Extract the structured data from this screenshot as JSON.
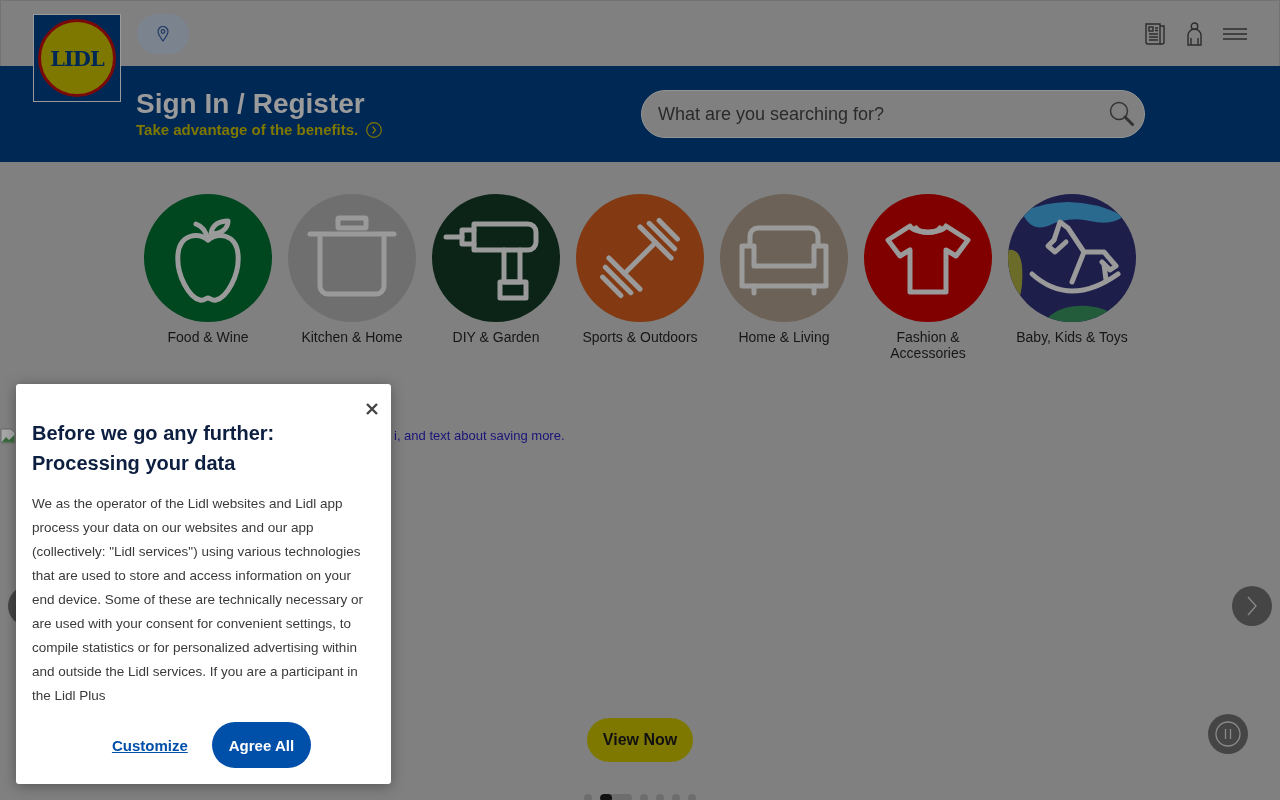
{
  "header": {
    "logo": {
      "text": "LIDL"
    },
    "sign_in": {
      "title": "Sign In / Register",
      "subtitle": "Take advantage of the benefits."
    },
    "search": {
      "placeholder": "What are you searching for?"
    }
  },
  "categories": [
    {
      "label": "Food & Wine",
      "color": "#00461e"
    },
    {
      "label": "Kitchen & Home",
      "color": "#6f6f6f"
    },
    {
      "label": "DIY & Garden",
      "color": "#0c2418"
    },
    {
      "label": "Sports & Outdoors",
      "color": "#833a12"
    },
    {
      "label": "Home & Living",
      "color": "#6c6257"
    },
    {
      "label": "Fashion & Accessories",
      "color": "#800000"
    },
    {
      "label": "Baby, Kids & Toys",
      "color": "#1e1e4b"
    }
  ],
  "banner": {
    "image_alt": "i, and text about saving more.",
    "button": "View Now",
    "indicators": [
      {
        "selected": false
      },
      {
        "selected": true,
        "level": 0.375
      },
      {
        "selected": false
      },
      {
        "selected": false
      },
      {
        "selected": false
      },
      {
        "selected": false
      }
    ]
  },
  "cookie_dialog": {
    "title": "Before we go any further: Processing your data",
    "body": "We as the operator of the Lidl websites and Lidl app process your data on our websites and our app (collectively: \"Lidl services\") using various technologies that are used to store and access information on your end device. Some of these are technically necessary or are used with your consent for convenient settings, to compile statistics or for personalized advertising within and outside the Lidl services. If you are a participant in the Lidl Plus",
    "buttons": [
      {
        "label": "Customize",
        "kind": "link"
      },
      {
        "label": "Agree All",
        "kind": "primary"
      }
    ]
  }
}
